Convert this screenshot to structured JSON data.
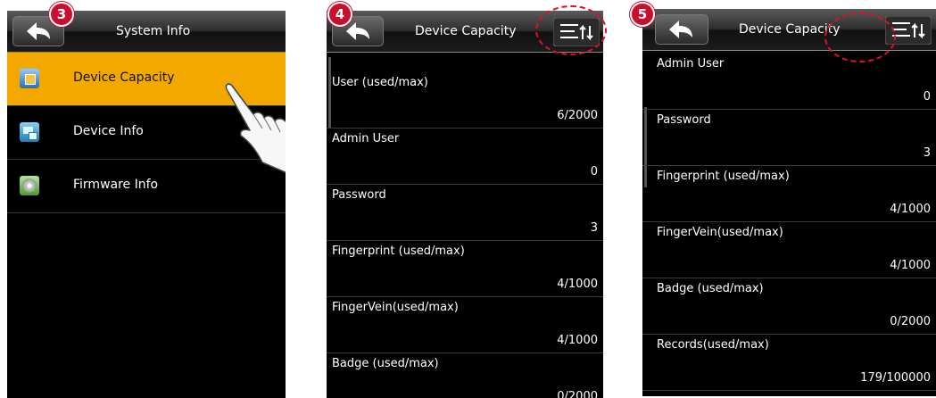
{
  "steps": [
    "3",
    "4",
    "5"
  ],
  "screen1": {
    "title": "System Info",
    "items": [
      {
        "label": "Device Capacity",
        "selected": true
      },
      {
        "label": "Device Info",
        "selected": false
      },
      {
        "label": "Firmware Info",
        "selected": false
      }
    ]
  },
  "screen2": {
    "title": "Device Capacity",
    "rows": [
      {
        "label": "User (used/max)",
        "value": "6/2000"
      },
      {
        "label": "Admin User",
        "value": "0"
      },
      {
        "label": "Password",
        "value": "3"
      },
      {
        "label": "Fingerprint (used/max)",
        "value": "4/1000"
      },
      {
        "label": "FingerVein(used/max)",
        "value": "4/1000"
      },
      {
        "label": "Badge (used/max)",
        "value": "0/2000"
      }
    ]
  },
  "screen3": {
    "title": "Device Capacity",
    "rows": [
      {
        "label": "Admin User",
        "value": "0"
      },
      {
        "label": "Password",
        "value": "3"
      },
      {
        "label": "Fingerprint (used/max)",
        "value": "4/1000"
      },
      {
        "label": "FingerVein(used/max)",
        "value": "4/1000"
      },
      {
        "label": "Badge (used/max)",
        "value": "0/2000"
      },
      {
        "label": "Records(used/max)",
        "value": "179/100000"
      }
    ]
  },
  "colors": {
    "selected": "#f3a800",
    "marker": "#c8102e"
  }
}
